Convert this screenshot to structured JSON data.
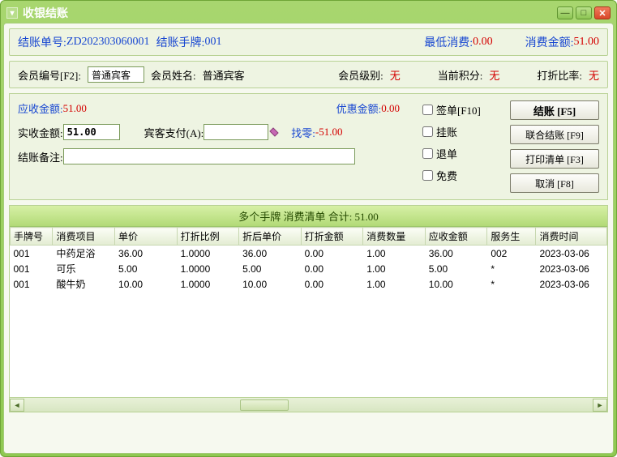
{
  "window": {
    "title": "收银结账"
  },
  "header": {
    "order_label": "结账单号:",
    "order_no": "ZD202303060001",
    "hand_label": "结账手牌:",
    "hand_no": "001",
    "min_label": "最低消费:",
    "min_value": "0.00",
    "amount_label": "消费金额:",
    "amount_value": "51.00"
  },
  "member": {
    "id_label": "会员编号[F2]:",
    "id_value": "普通宾客",
    "name_label": "会员姓名:",
    "name_value": "普通宾客",
    "level_label": "会员级别:",
    "level_value": "无",
    "points_label": "当前积分:",
    "points_value": "无",
    "discount_label": "打折比率:",
    "discount_value": "无"
  },
  "payment": {
    "receivable_label": "应收金额:",
    "receivable_value": "51.00",
    "discount_amt_label": "优惠金额:",
    "discount_amt_value": "0.00",
    "actual_label": "实收金额:",
    "actual_value": "51.00",
    "guest_pay_label": "宾客支付(A):",
    "guest_pay_value": "",
    "change_label": "找零:",
    "change_value": "-51.00",
    "remark_label": "结账备注:",
    "remark_value": ""
  },
  "checks": {
    "sign": "签单[F10]",
    "credit": "挂账",
    "return": "退单",
    "free": "免费"
  },
  "buttons": {
    "settle": "结账 [F5]",
    "union": "联合结账 [F9]",
    "print": "打印清单 [F3]",
    "cancel": "取消 [F8]"
  },
  "table": {
    "title": "多个手牌  消费清单  合计: 51.00",
    "columns": [
      "手牌号",
      "消费项目",
      "单价",
      "打折比例",
      "折后单价",
      "打折金额",
      "消费数量",
      "应收金额",
      "服务生",
      "消费时间"
    ],
    "rows": [
      {
        "c": [
          "001",
          "中药足浴",
          "36.00",
          "1.0000",
          "36.00",
          "0.00",
          "1.00",
          "36.00",
          "002",
          "2023-03-06"
        ]
      },
      {
        "c": [
          "001",
          "可乐",
          "5.00",
          "1.0000",
          "5.00",
          "0.00",
          "1.00",
          "5.00",
          "*",
          "2023-03-06"
        ]
      },
      {
        "c": [
          "001",
          "酸牛奶",
          "10.00",
          "1.0000",
          "10.00",
          "0.00",
          "1.00",
          "10.00",
          "*",
          "2023-03-06"
        ]
      }
    ]
  }
}
